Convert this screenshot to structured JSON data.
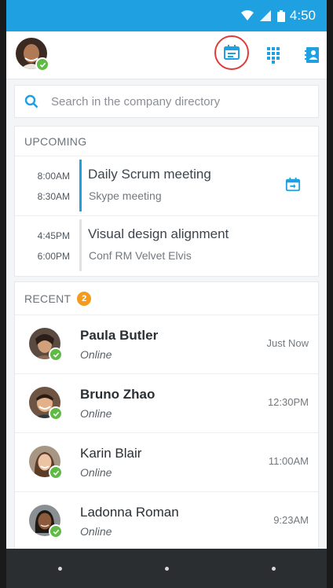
{
  "status_bar": {
    "time": "4:50",
    "wifi_icon": "wifi-icon",
    "signal_icon": "signal-icon",
    "battery_icon": "battery-icon"
  },
  "toolbar": {
    "me_avatar_status": "online",
    "meetings_icon": "calendar-icon",
    "dialpad_icon": "dialpad-icon",
    "contacts_icon": "contacts-book-icon"
  },
  "search": {
    "placeholder": "Search in the company directory"
  },
  "upcoming": {
    "heading": "UPCOMING",
    "meetings": [
      {
        "start": "8:00AM",
        "end": "8:30AM",
        "title": "Daily Scrum meeting",
        "subtitle": "Skype meeting",
        "accent": "#1fa0e0",
        "joinable": true
      },
      {
        "start": "4:45PM",
        "end": "6:00PM",
        "title": "Visual design alignment",
        "subtitle": "Conf RM Velvet Elvis",
        "accent": "#dfe2e5",
        "joinable": false
      }
    ]
  },
  "recent": {
    "heading": "RECENT",
    "badge": "2",
    "contacts": [
      {
        "name": "Paula Butler",
        "status": "Online",
        "time": "Just Now",
        "unread": true
      },
      {
        "name": "Bruno Zhao",
        "status": "Online",
        "time": "12:30PM",
        "unread": true
      },
      {
        "name": "Karin Blair",
        "status": "Online",
        "time": "11:00AM",
        "unread": false
      },
      {
        "name": "Ladonna Roman",
        "status": "Online",
        "time": "9:23AM",
        "unread": false
      }
    ]
  },
  "colors": {
    "accent": "#1fa0e0",
    "presence": "#5fbb46",
    "badge": "#f39b1d",
    "highlight_ring": "#e03a3a"
  }
}
